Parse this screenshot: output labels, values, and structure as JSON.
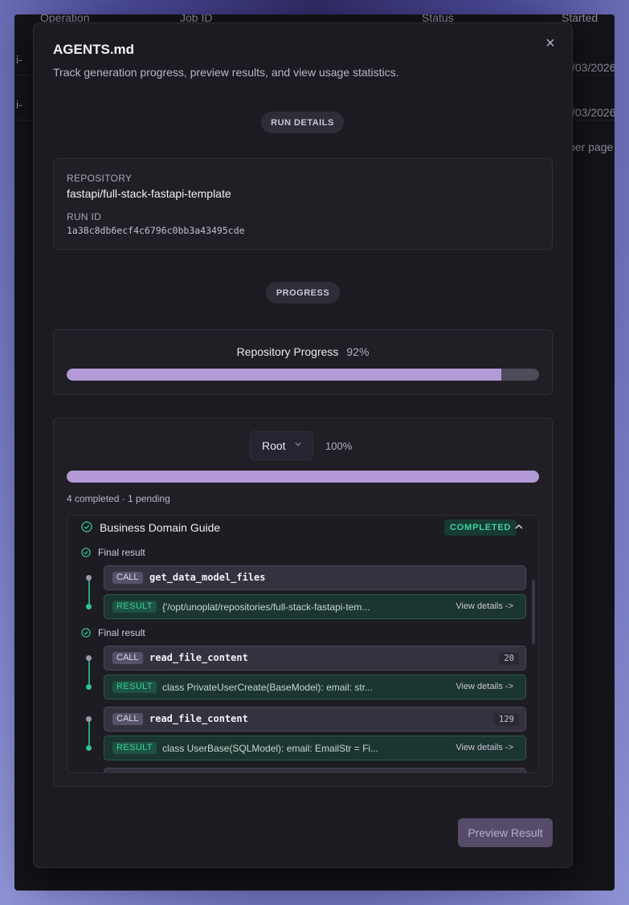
{
  "background": {
    "header": {
      "operation": "Operation",
      "job_id": "Job ID",
      "status": "Status",
      "started": "Started"
    },
    "rows": [
      {
        "prefix": "i-",
        "date": "/03/2026"
      },
      {
        "prefix": "i-",
        "date": "/03/2026"
      }
    ],
    "footer": "per page"
  },
  "modal": {
    "title": "AGENTS.md",
    "subtitle": "Track generation progress, preview results, and view usage statistics.",
    "close_icon": "×"
  },
  "run_details": {
    "section_label": "RUN DETAILS",
    "repository_label": "REPOSITORY",
    "repository_value": "fastapi/full-stack-fastapi-template",
    "run_id_label": "RUN ID",
    "run_id_value": "1a38c8db6ecf4c6796c0bb3a43495cde"
  },
  "progress": {
    "section_label": "PROGRESS",
    "repository_title": "Repository Progress",
    "repository_percent_text": "92%",
    "repository_percent": 92,
    "scope_select": "Root",
    "scope_percent_text": "100%",
    "scope_percent": 100,
    "summary": "4 completed · 1 pending"
  },
  "task": {
    "title": "Business Domain Guide",
    "status": "COMPLETED",
    "groups": [
      {
        "label": "Final result",
        "calls": [
          {
            "tag": "CALL",
            "fn": "get_data_model_files",
            "count": "",
            "result_tag": "RESULT",
            "result": "{'/opt/unoplat/repositories/full-stack-fastapi-tem...",
            "link": "View details ->"
          }
        ]
      },
      {
        "label": "Final result",
        "calls": [
          {
            "tag": "CALL",
            "fn": "read_file_content",
            "count": "20",
            "result_tag": "RESULT",
            "result": "class PrivateUserCreate(BaseModel): email: str...",
            "link": "View details ->"
          },
          {
            "tag": "CALL",
            "fn": "read_file_content",
            "count": "129",
            "result_tag": "RESULT",
            "result": "class UserBase(SQLModel): email: EmailStr = Fi...",
            "link": "View details ->"
          }
        ]
      }
    ]
  },
  "footer": {
    "preview_button": "Preview Result"
  },
  "colors": {
    "accent": "#b39ad6",
    "success": "#34d399",
    "surface": "#1c1b22"
  }
}
